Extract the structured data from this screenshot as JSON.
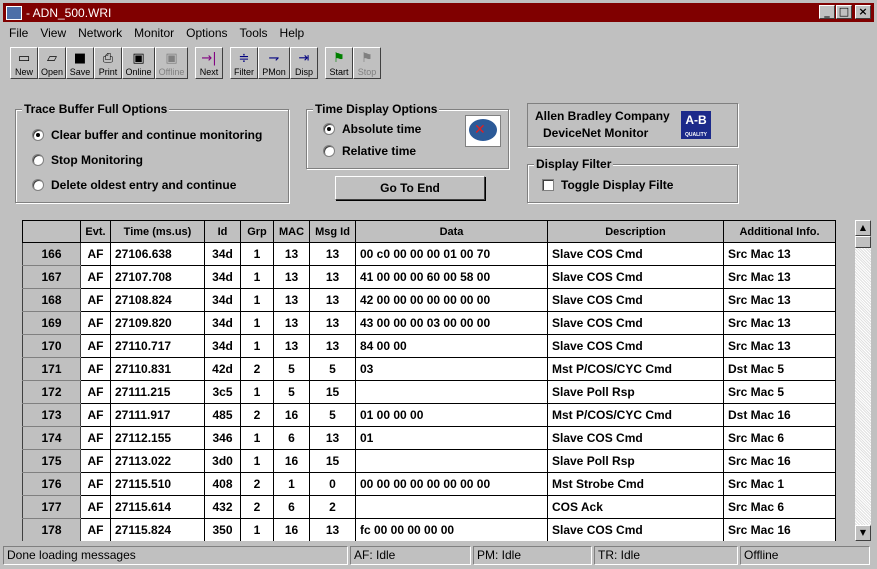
{
  "window": {
    "title": "- ADN_500.WRI",
    "min_label": "_",
    "max_label": "□",
    "close_label": "×"
  },
  "menu": [
    {
      "label": "File"
    },
    {
      "label": "View"
    },
    {
      "label": "Network"
    },
    {
      "label": "Monitor"
    },
    {
      "label": "Options"
    },
    {
      "label": "Tools"
    },
    {
      "label": "Help"
    }
  ],
  "toolbar": {
    "new": "New",
    "open": "Open",
    "save": "Save",
    "print": "Print",
    "online": "Online",
    "offline": "Offline",
    "next": "Next",
    "filter": "Filter",
    "pmon": "PMon",
    "disp": "Disp",
    "start": "Start",
    "stop": "Stop"
  },
  "trace_buffer": {
    "legend": "Trace Buffer Full Options",
    "options": [
      "Clear buffer and continue monitoring",
      "Stop Monitoring",
      "Delete oldest entry and continue"
    ],
    "selected": 0
  },
  "time_display": {
    "legend": "Time Display Options",
    "options": [
      "Absolute time",
      "Relative time"
    ],
    "selected": 0
  },
  "goto_end": "Go To End",
  "company": {
    "line1": "Allen Bradley Company",
    "line2": "DeviceNet Monitor",
    "logo": "A-B",
    "logo_sub": "QUALITY"
  },
  "display_filter": {
    "legend": "Display Filter",
    "toggle_label": "Toggle Display Filte",
    "checked": false
  },
  "table": {
    "headers": [
      "",
      "Evt.",
      "Time (ms.us)",
      "Id",
      "Grp",
      "MAC",
      "Msg Id",
      "Data",
      "Description",
      "Additional Info."
    ],
    "rows": [
      [
        "166",
        "AF",
        "27106.638",
        "34d",
        "1",
        "13",
        "13",
        "00 c0 00 00 00 01 00 70",
        "Slave COS Cmd",
        "Src Mac 13"
      ],
      [
        "167",
        "AF",
        "27107.708",
        "34d",
        "1",
        "13",
        "13",
        "41 00 00 00 60 00 58 00",
        "Slave COS Cmd",
        "Src Mac 13"
      ],
      [
        "168",
        "AF",
        "27108.824",
        "34d",
        "1",
        "13",
        "13",
        "42 00 00 00 00 00 00 00",
        "Slave COS Cmd",
        "Src Mac 13"
      ],
      [
        "169",
        "AF",
        "27109.820",
        "34d",
        "1",
        "13",
        "13",
        "43 00 00 00 03 00 00 00",
        "Slave COS Cmd",
        "Src Mac 13"
      ],
      [
        "170",
        "AF",
        "27110.717",
        "34d",
        "1",
        "13",
        "13",
        "84 00 00",
        "Slave COS Cmd",
        "Src Mac 13"
      ],
      [
        "171",
        "AF",
        "27110.831",
        "42d",
        "2",
        "5",
        "5",
        "03",
        "Mst P/COS/CYC Cmd",
        "Dst Mac 5"
      ],
      [
        "172",
        "AF",
        "27111.215",
        "3c5",
        "1",
        "5",
        "15",
        "",
        "Slave Poll Rsp",
        "Src Mac 5"
      ],
      [
        "173",
        "AF",
        "27111.917",
        "485",
        "2",
        "16",
        "5",
        "01 00 00 00",
        "Mst P/COS/CYC Cmd",
        "Dst Mac 16"
      ],
      [
        "174",
        "AF",
        "27112.155",
        "346",
        "1",
        "6",
        "13",
        "01",
        "Slave COS Cmd",
        "Src Mac 6"
      ],
      [
        "175",
        "AF",
        "27113.022",
        "3d0",
        "1",
        "16",
        "15",
        "",
        "Slave Poll Rsp",
        "Src Mac 16"
      ],
      [
        "176",
        "AF",
        "27115.510",
        "408",
        "2",
        "1",
        "0",
        "00 00 00 00 00 00 00 00",
        "Mst Strobe Cmd",
        "Src Mac 1"
      ],
      [
        "177",
        "AF",
        "27115.614",
        "432",
        "2",
        "6",
        "2",
        "",
        "COS Ack",
        "Src Mac 6"
      ],
      [
        "178",
        "AF",
        "27115.824",
        "350",
        "1",
        "16",
        "13",
        "fc 00 00 00 00 00",
        "Slave COS Cmd",
        "Src Mac 16"
      ]
    ]
  },
  "status": {
    "message": "Done loading messages",
    "af": "AF: Idle",
    "pm": "PM: Idle",
    "tr": "TR: Idle",
    "mode": "Offline"
  }
}
